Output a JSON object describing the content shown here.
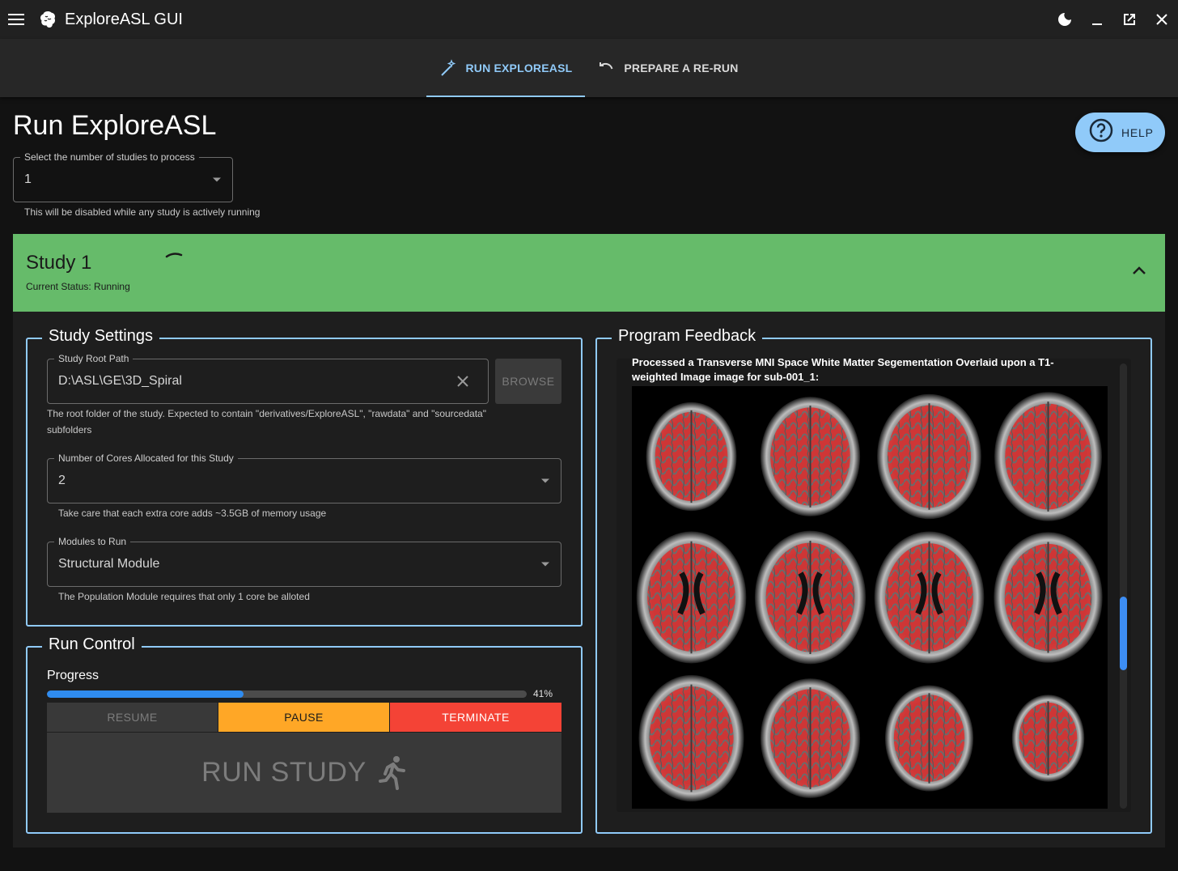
{
  "app": {
    "title": "ExploreASL GUI"
  },
  "tabs": [
    {
      "label": "RUN EXPLOREASL",
      "active": true
    },
    {
      "label": "PREPARE A RE-RUN",
      "active": false
    }
  ],
  "page": {
    "title": "Run ExploreASL",
    "help_label": "HELP"
  },
  "study_count": {
    "label": "Select the number of studies to process",
    "value": "1",
    "helper": "This will be disabled while any study is actively running"
  },
  "study": {
    "title": "Study 1",
    "status": "Current Status: Running"
  },
  "settings": {
    "legend": "Study Settings",
    "root_path": {
      "label": "Study Root Path",
      "value": "D:\\ASL\\GE\\3D_Spiral",
      "helper_line1": "The root folder of the study. Expected to contain \"derivatives/ExploreASL\", \"rawdata\" and \"sourcedata\"",
      "helper_line2": "subfolders",
      "browse_label": "BROWSE"
    },
    "cores": {
      "label": "Number of Cores Allocated for this Study",
      "value": "2",
      "helper": "Take care that each extra core adds ~3.5GB of memory usage"
    },
    "modules": {
      "label": "Modules to Run",
      "value": "Structural Module",
      "helper": "The Population Module requires that only 1 core be alloted"
    }
  },
  "run_control": {
    "legend": "Run Control",
    "progress_label": "Progress",
    "progress_fraction": 0.41,
    "progress_text": "41%",
    "resume_label": "RESUME",
    "pause_label": "PAUSE",
    "terminate_label": "TERMINATE",
    "run_study_label": "RUN STUDY"
  },
  "feedback": {
    "legend": "Program Feedback",
    "message_line1": "Processed a Transverse MNI Space White Matter Segementation Overlaid upon a T1-",
    "message_line2": "weighted Image image for sub-001_1:"
  },
  "colors": {
    "accent": "#90caf9",
    "study_header": "#66bb6a",
    "progress": "#2f8cf0",
    "pause": "#ffa726",
    "terminate": "#f44336"
  }
}
